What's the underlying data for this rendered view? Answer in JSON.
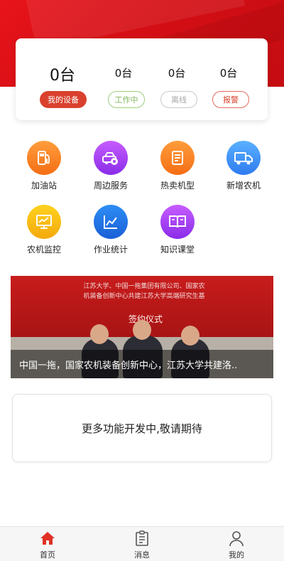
{
  "stats": {
    "total": "0台",
    "working": "0台",
    "offline": "0台",
    "alarm": "0台"
  },
  "stat_buttons": {
    "mine": "我的设备",
    "working": "工作中",
    "offline": "离线",
    "alarm": "报警"
  },
  "menu": [
    {
      "label": "加油站",
      "icon": "fuel-pump-icon"
    },
    {
      "label": "周边服务",
      "icon": "repair-service-icon"
    },
    {
      "label": "热卖机型",
      "icon": "document-list-icon"
    },
    {
      "label": "新增农机",
      "icon": "truck-icon"
    },
    {
      "label": "农机监控",
      "icon": "monitor-chart-icon"
    },
    {
      "label": "作业统计",
      "icon": "line-chart-icon"
    },
    {
      "label": "知识课堂",
      "icon": "book-icon"
    }
  ],
  "banner": {
    "heading_line1": "江苏大学、中国一拖集团有限公司、国家农",
    "heading_line2": "机装备创新中心共建江苏大学高端研究生基",
    "ceremony": "签约仪式",
    "caption": "中国一拖，国家农机装备创新中心，江苏大学共建洛.."
  },
  "coming_soon": "更多功能开发中,敬请期待",
  "tabs": [
    {
      "label": "首页",
      "icon": "home-icon",
      "active": true
    },
    {
      "label": "消息",
      "icon": "message-icon",
      "active": false
    },
    {
      "label": "我的",
      "icon": "user-icon",
      "active": false
    }
  ],
  "colors": {
    "brand_red": "#d9412e",
    "header_red": "#e8141b",
    "working_green": "#7fb65b",
    "offline_gray": "#a8a8a8"
  }
}
